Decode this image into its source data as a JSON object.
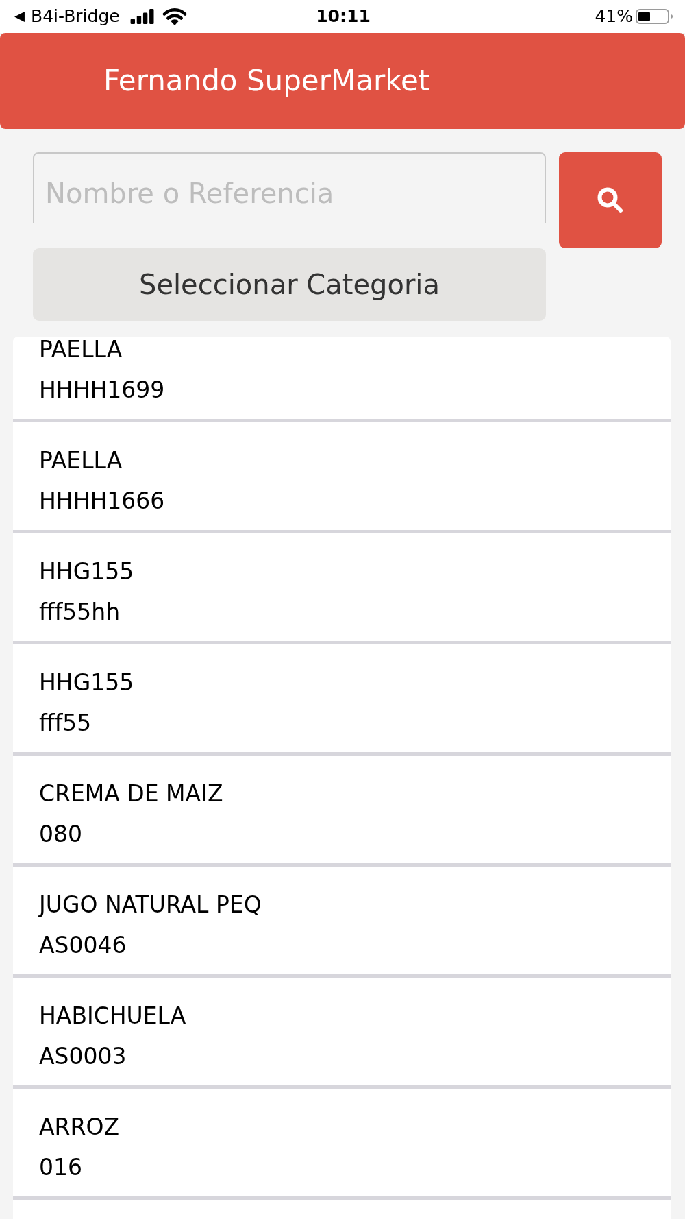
{
  "status_bar": {
    "back_label": "B4i-Bridge",
    "time": "10:11",
    "battery": "41%"
  },
  "header": {
    "title": "Fernando SuperMarket"
  },
  "search": {
    "placeholder": "Nombre o Referencia"
  },
  "category_button": {
    "label": "Seleccionar Categoria"
  },
  "products": [
    {
      "name": "PAELLA",
      "reference": "HHHH1699"
    },
    {
      "name": "PAELLA",
      "reference": "HHHH1666"
    },
    {
      "name": "HHG155",
      "reference": "fff55hh"
    },
    {
      "name": "HHG155",
      "reference": "fff55"
    },
    {
      "name": "CREMA DE MAIZ",
      "reference": "080"
    },
    {
      "name": "JUGO NATURAL PEQ",
      "reference": "AS0046"
    },
    {
      "name": "HABICHUELA",
      "reference": "AS0003"
    },
    {
      "name": "ARROZ",
      "reference": "016"
    }
  ]
}
